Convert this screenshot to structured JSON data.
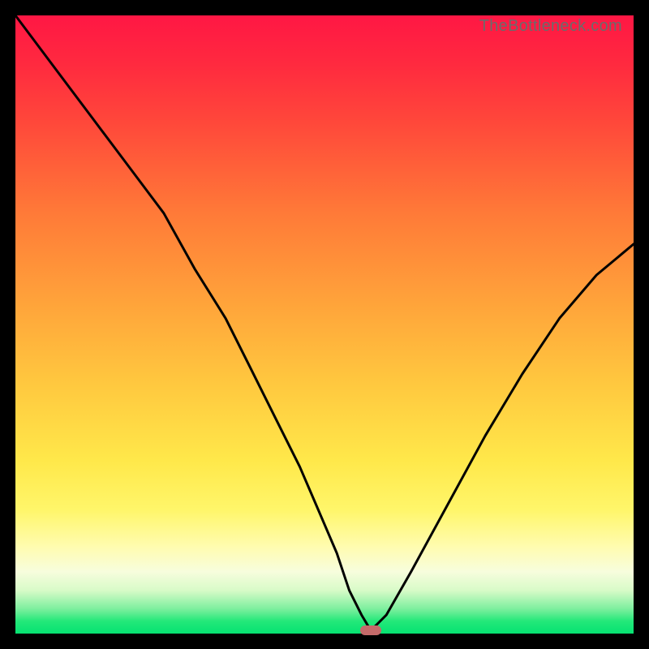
{
  "watermark": "TheBottleneck.com",
  "colors": {
    "frame": "#000000",
    "curve": "#000000",
    "marker": "#c56a6a",
    "gradient_top": "#ff1744",
    "gradient_bottom": "#06e272"
  },
  "chart_data": {
    "type": "line",
    "title": "",
    "xlabel": "",
    "ylabel": "",
    "xlim": [
      0,
      100
    ],
    "ylim": [
      0,
      100
    ],
    "annotations": [
      {
        "text": "TheBottleneck.com",
        "position": "top-right"
      }
    ],
    "series": [
      {
        "name": "bottleneck-curve",
        "x": [
          0,
          6,
          12,
          18,
          24,
          29,
          34,
          38,
          42,
          46,
          49,
          52,
          54,
          56,
          57.5,
          60,
          64,
          70,
          76,
          82,
          88,
          94,
          100
        ],
        "values": [
          100,
          92,
          84,
          76,
          68,
          59,
          51,
          43,
          35,
          27,
          20,
          13,
          7,
          3,
          0.5,
          3,
          10,
          21,
          32,
          42,
          51,
          58,
          63
        ]
      }
    ],
    "marker": {
      "x": 57.5,
      "y": 0.5
    },
    "notes": "V-shaped bottleneck curve over vertical traffic-light gradient; minimum near x≈57% where bottleneck ≈0%."
  }
}
